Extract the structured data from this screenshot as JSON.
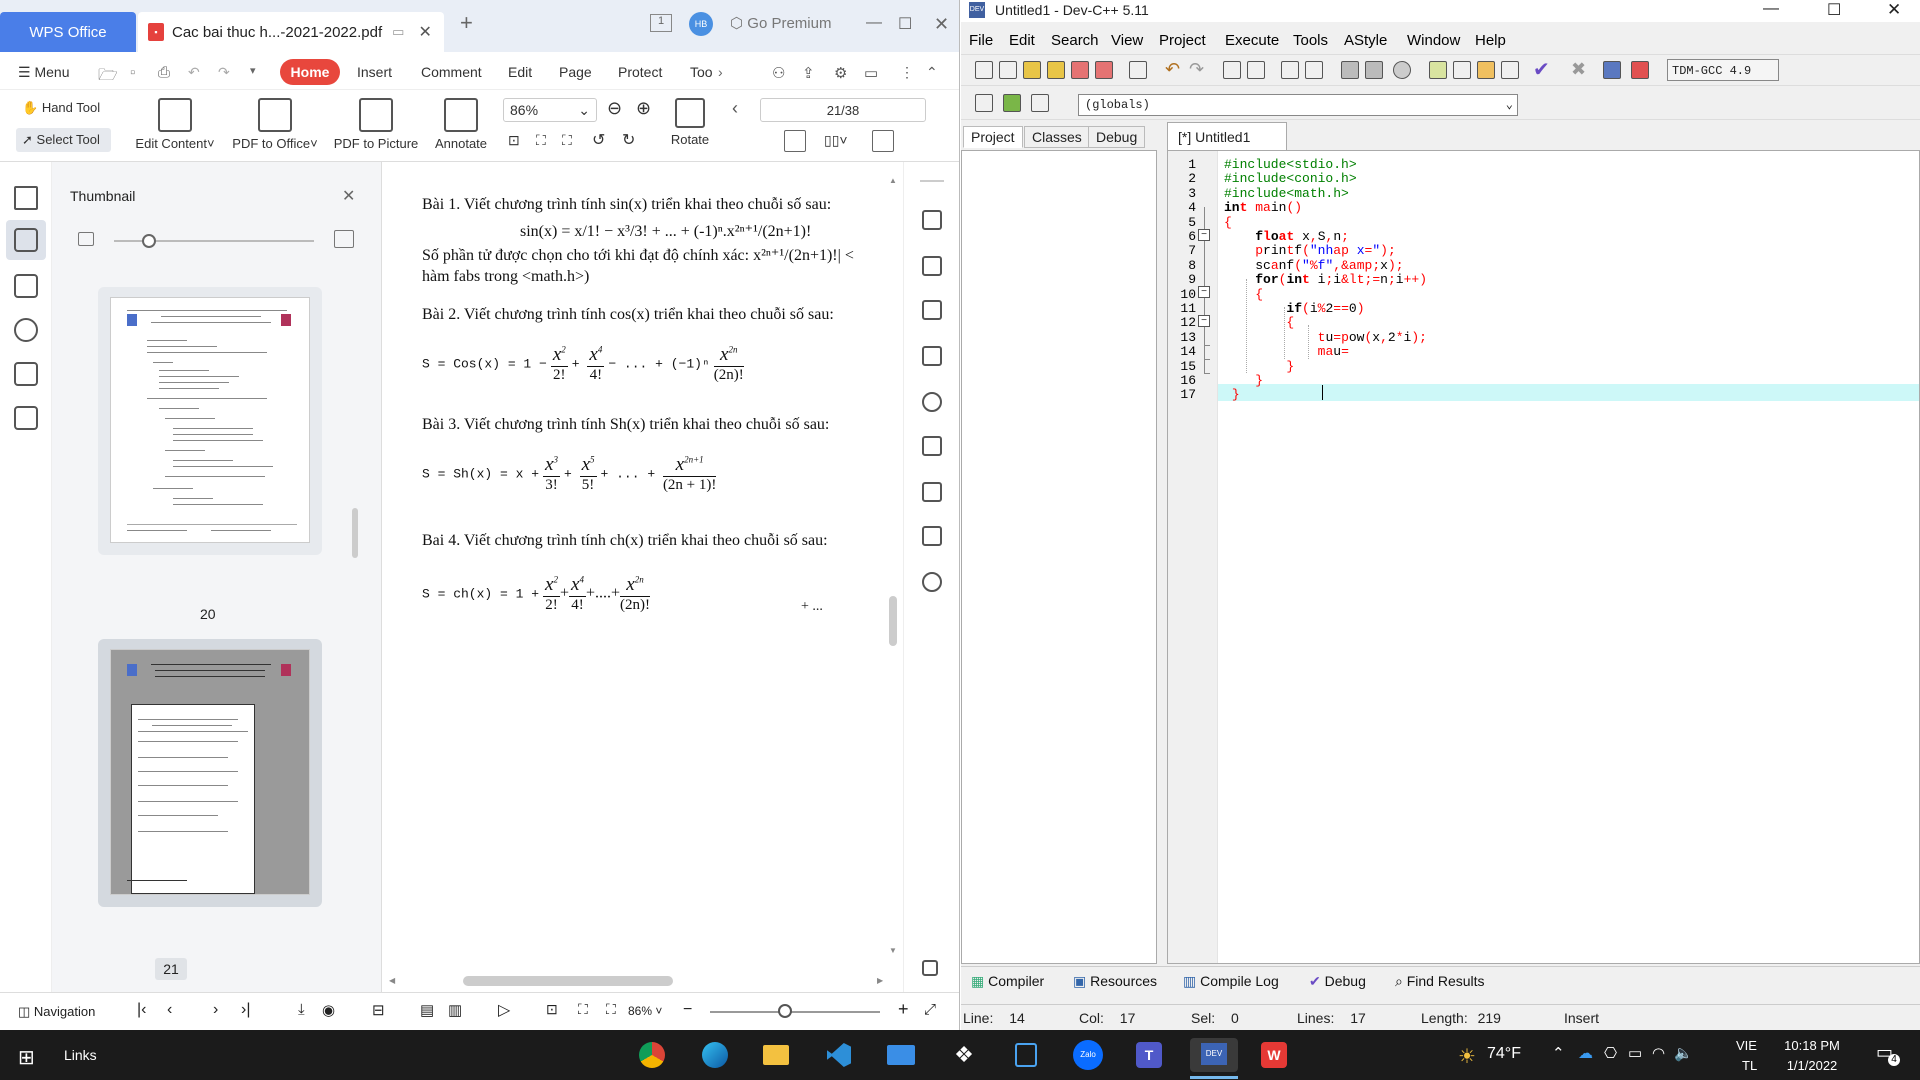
{
  "wps": {
    "app_tab": "WPS Office",
    "doc_tab": "Cac bai thuc h...-2021-2022.pdf",
    "go_premium": "Go Premium",
    "menu": "Menu",
    "tabs": [
      "Home",
      "Insert",
      "Comment",
      "Edit",
      "Page",
      "Protect",
      "Too"
    ],
    "tools": {
      "hand": "Hand Tool",
      "select": "Select Tool",
      "edit_content": "Edit Content",
      "pdf_to_office": "PDF to Office",
      "pdf_to_picture": "PDF to Picture",
      "annotate": "Annotate",
      "zoom": "86%",
      "page_counter": "21/38",
      "rotate": "Rotate"
    },
    "thumbnail_title": "Thumbnail",
    "thumb_pages": [
      "20",
      "21"
    ],
    "document": {
      "bai1_line1": "Bài  1. Viết chương trình tính sin(x) triển khai theo chuỗi số sau:",
      "bai1_formula": "sin(x) = x/1! − x³/3! + ... + (-1)ⁿ.x²ⁿ⁺¹/(2n+1)!",
      "bai1_line2": "Số phần tử được chọn cho tới khi đạt độ chính xác: x²ⁿ⁺¹/(2n+1)!| <",
      "bai1_line3": "hàm fabs trong <math.h>)",
      "bai2": "Bài 2. Viết chương trình tính cos(x) triển khai theo chuỗi số sau:",
      "bai2_lhs": "S = Cos(x) = 1 −",
      "bai3": "Bài 3. Viết chương trình tính Sh(x) triển khai theo chuỗi số sau:",
      "bai3_lhs": "S = Sh(x) = x +",
      "bai4": "Bai 4. Viết chương trình tính ch(x) triển khai theo chuỗi số sau:",
      "bai4_lhs": "S = ch(x) = 1 +",
      "bai4_tail": "+ ..."
    },
    "status": {
      "navigation": "Navigation",
      "zoom": "86%"
    }
  },
  "devcpp": {
    "title": "Untitled1 - Dev-C++ 5.11",
    "menu": [
      "File",
      "Edit",
      "Search",
      "View",
      "Project",
      "Execute",
      "Tools",
      "AStyle",
      "Window",
      "Help"
    ],
    "compiler_combo": "TDM-GCC 4.9",
    "globals": "(globals)",
    "left_tabs": [
      "Project",
      "Classes",
      "Debug"
    ],
    "editor_tab": "[*] Untitled1",
    "code_lines": [
      "#include<stdio.h>",
      "#include<conio.h>",
      "#include<math.h>",
      "int main()",
      "{",
      "    float x,S,n;",
      "    printf(\"nhap x=\");",
      "    scanf(\"%f\",&x);",
      "    for(int i;i<=n;i++)",
      "    {",
      "        if(i%2==0)",
      "        {",
      "            tu=pow(x,2*i);",
      "            mau=",
      "        }",
      "    }",
      " }"
    ],
    "bottom_tabs": [
      "Compiler",
      "Resources",
      "Compile Log",
      "Debug",
      "Find Results"
    ],
    "status": {
      "line_label": "Line:",
      "line": "14",
      "col_label": "Col:",
      "col": "17",
      "sel_label": "Sel:",
      "sel": "0",
      "lines_label": "Lines:",
      "lines": "17",
      "length_label": "Length:",
      "length": "219",
      "mode": "Insert"
    }
  },
  "taskbar": {
    "links": "Links",
    "weather": "74°F",
    "lang1": "VIE",
    "lang2": "TL",
    "time": "10:18 PM",
    "date": "1/1/2022",
    "notifications": "4"
  },
  "colors": {
    "wps_accent": "#4a7ee8",
    "home_tab": "#e8473d",
    "editor_highlight": "#cdf8f8",
    "taskbar": "#1b1b1b"
  }
}
